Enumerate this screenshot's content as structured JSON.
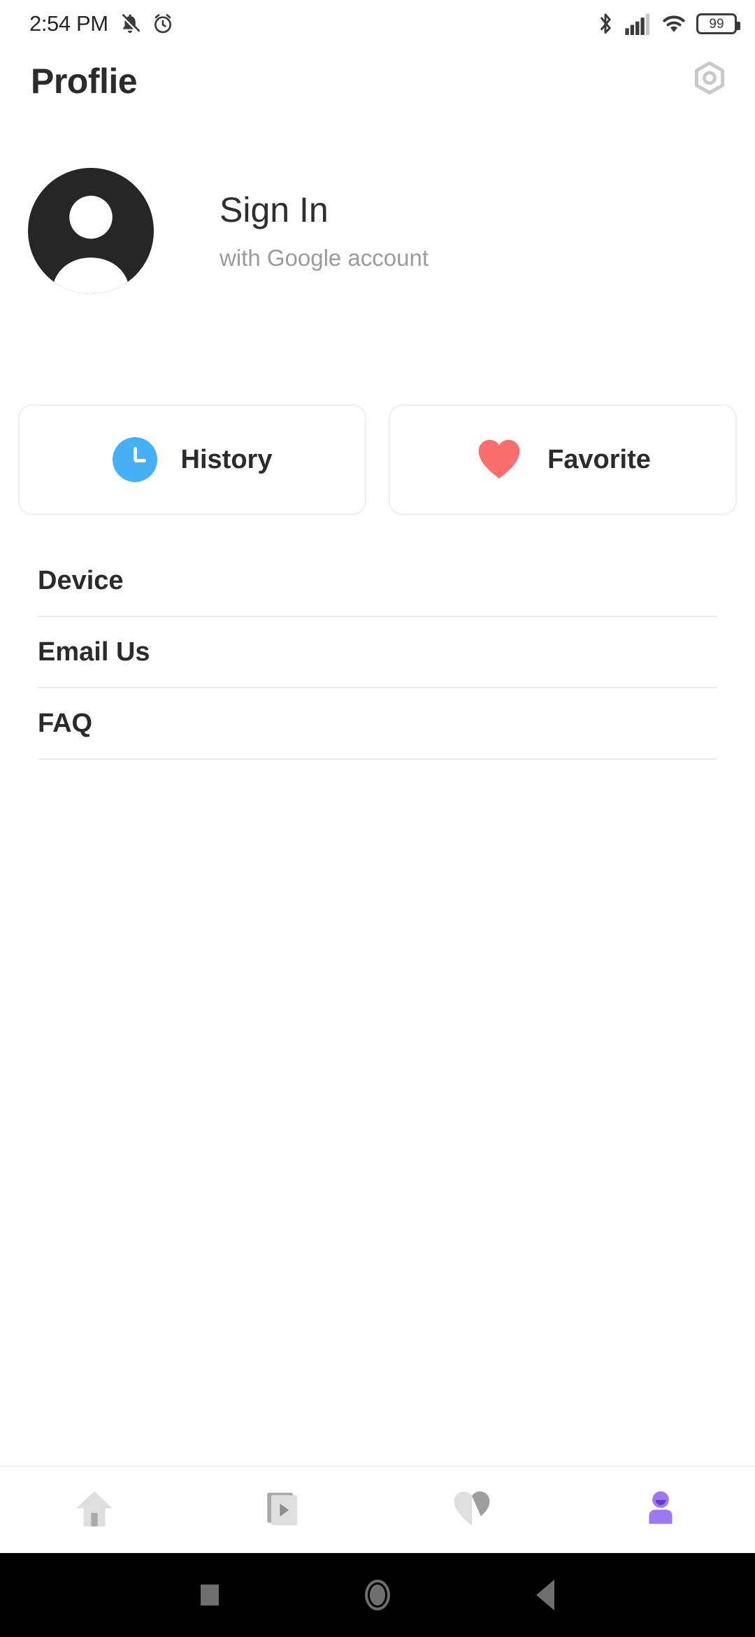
{
  "status_bar": {
    "time": "2:54 PM",
    "battery_level": "99",
    "left_icons": [
      "silent-bell-icon",
      "alarm-icon"
    ],
    "right_icons": [
      "bluetooth-icon",
      "cellular-signal-icon",
      "wifi-icon",
      "battery-icon"
    ]
  },
  "app_bar": {
    "title": "Proflie",
    "action_icon": "settings-hexagon-icon"
  },
  "profile": {
    "avatar_icon": "default-user-avatar",
    "title": "Sign In",
    "subtitle": "with Google account"
  },
  "shortcuts": [
    {
      "label": "History",
      "icon": "clock-icon",
      "color": "#45b0f3"
    },
    {
      "label": "Favorite",
      "icon": "heart-icon",
      "color": "#fa6e6e"
    }
  ],
  "menu_items": [
    {
      "label": "Device"
    },
    {
      "label": "Email Us"
    },
    {
      "label": "FAQ"
    }
  ],
  "bottom_nav": [
    {
      "name": "home",
      "icon": "home-icon",
      "active": false,
      "color": "#d6d6d6"
    },
    {
      "name": "videos",
      "icon": "video-play-icon",
      "active": false,
      "color": "#d6d6d6"
    },
    {
      "name": "favorites",
      "icon": "heart-icon",
      "active": false,
      "color": "#d6d6d6"
    },
    {
      "name": "profile",
      "icon": "person-icon",
      "active": true,
      "color": "#9d7bee"
    }
  ],
  "android_nav": {
    "recents": "square-icon",
    "home": "circle-icon",
    "back": "triangle-back-icon"
  },
  "colors": {
    "accent_purple": "#9d7bee",
    "history_blue": "#45b0f3",
    "favorite_red": "#fa6e6e",
    "text_dark": "#2b2b2b",
    "text_muted": "#9b9b9b",
    "divider": "#ececec"
  }
}
